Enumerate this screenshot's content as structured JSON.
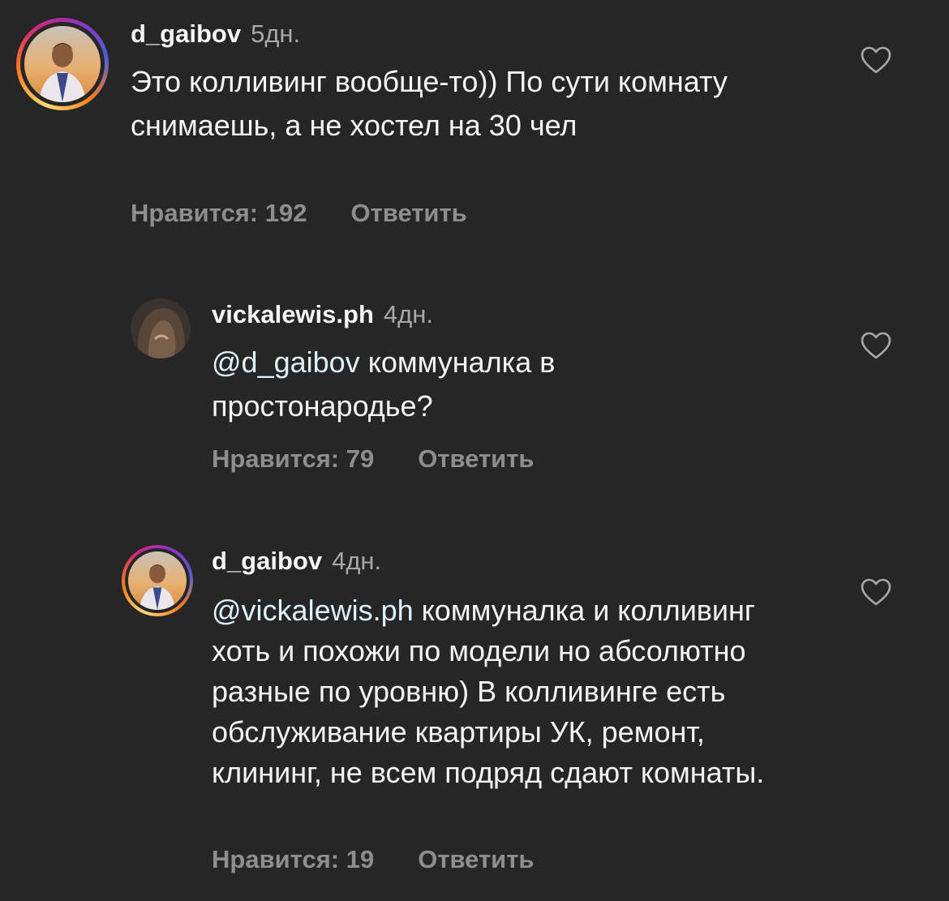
{
  "comments": [
    {
      "username": "d_gaibov",
      "time": "5дн.",
      "text": "Это колливинг вообще-то)) По сути комнату снимаешь, а не хостел на 30 чел",
      "mention": "",
      "likes_label": "Нравится: 192",
      "reply_label": "Ответить",
      "avatar": "profile-photo-man-sunset",
      "has_story_ring": true
    },
    {
      "username": "vickalewis.ph",
      "time": "4дн.",
      "mention": "@d_gaibov",
      "text": "коммуналка в простонародье?",
      "likes_label": "Нравится: 79",
      "reply_label": "Ответить",
      "avatar": "profile-photo-dark-hair",
      "has_story_ring": false
    },
    {
      "username": "d_gaibov",
      "time": "4дн.",
      "mention": "@vickalewis.ph",
      "text": "коммуналка и колливинг хоть и похожи по модели но абсолютно разные по уровню) В колливинге есть обслуживание квартиры УК, ремонт, клининг, не всем подряд сдают комнаты.",
      "likes_label": "Нравится: 19",
      "reply_label": "Ответить",
      "avatar": "profile-photo-man-sunset",
      "has_story_ring": true
    }
  ],
  "colors": {
    "background": "#262626",
    "text_primary": "#f5f5f5",
    "text_secondary": "#8e8e8e",
    "mention": "#e0f1ff"
  },
  "icons": {
    "like": "heart-outline-icon"
  }
}
